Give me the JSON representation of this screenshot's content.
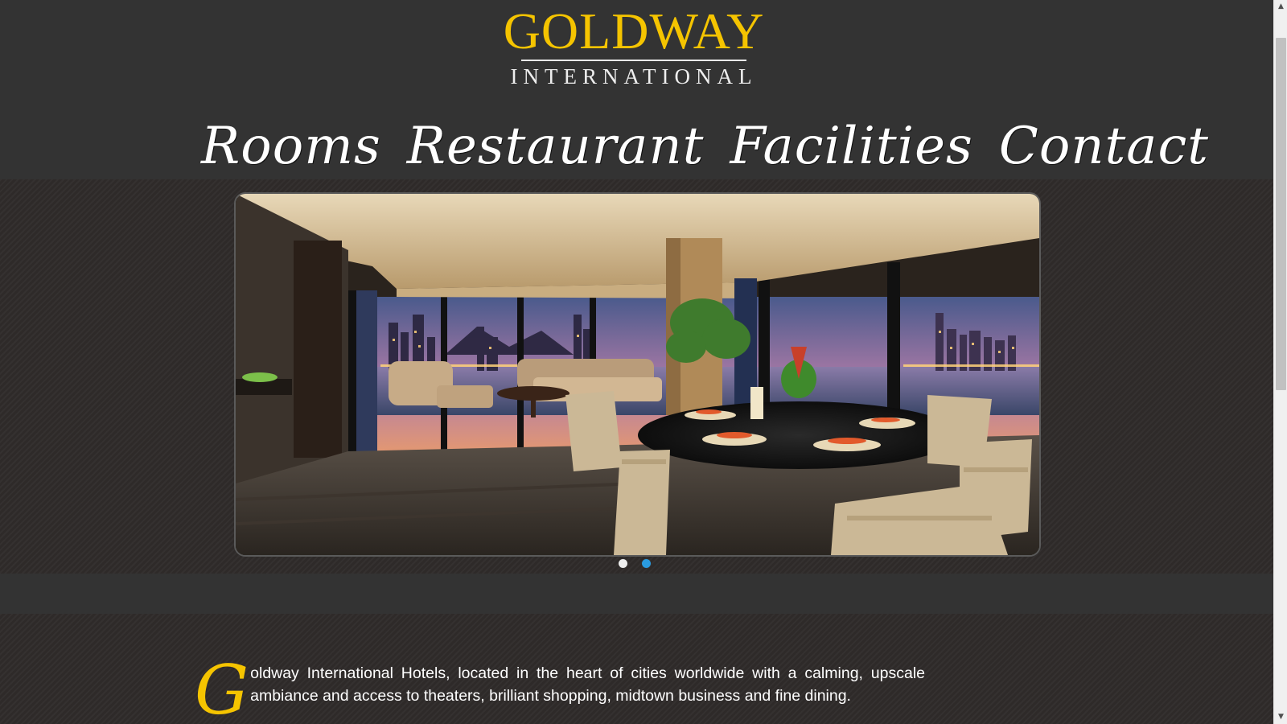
{
  "brand": {
    "name": "GOLDWAY",
    "subtitle": "INTERNATIONAL",
    "gold_color": "#f5c400"
  },
  "nav": {
    "items": [
      {
        "label": "Rooms"
      },
      {
        "label": "Restaurant"
      },
      {
        "label": "Facilities"
      },
      {
        "label": "Contact"
      }
    ]
  },
  "slider": {
    "image_subject": "hotel suite with dining table and city skyline at dusk",
    "slide_count": 2,
    "active_slide": 2,
    "active_dot_color": "#2a9be0"
  },
  "intro": {
    "drop_cap": "G",
    "text": "oldway International Hotels, located in the heart of cities worldwide with a calming, upscale ambiance and access to theaters, brilliant shopping, midtown business and fine dining."
  },
  "icons": {
    "scroll_up": "scroll-up-arrow-icon",
    "scroll_down": "scroll-down-arrow-icon"
  }
}
